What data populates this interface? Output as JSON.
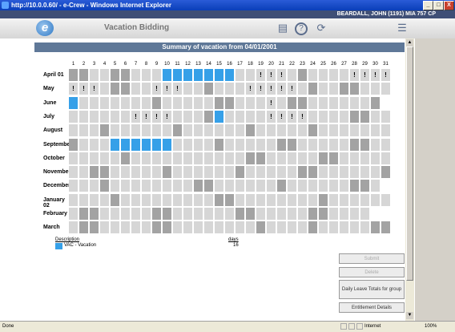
{
  "window": {
    "title": "http://10.0.0.60/ - e-Crew - Windows Internet Explorer",
    "minimize": "_",
    "maximize": "□",
    "close": "X"
  },
  "header": {
    "user": "BEARDALL, JOHN (1191) MIA 757 CP"
  },
  "toolbar": {
    "logo_letter": "e",
    "app_title": "Vacation Bidding",
    "print_icon": "printer-icon",
    "help_icon": "help-icon",
    "exit_icon": "exit-icon",
    "help_glyph": "?",
    "exit_glyph": "⟳",
    "print_glyph": "▤",
    "panel_glyph": "☰"
  },
  "summary": {
    "title": "Summary of vacation from  04/01/2001",
    "days": [
      "1",
      "2",
      "3",
      "4",
      "5",
      "6",
      "7",
      "8",
      "9",
      "10",
      "11",
      "12",
      "13",
      "14",
      "15",
      "16",
      "17",
      "18",
      "19",
      "20",
      "21",
      "22",
      "23",
      "24",
      "25",
      "26",
      "27",
      "28",
      "29",
      "30",
      "31"
    ],
    "months": [
      "April 01",
      "May",
      "June",
      "July",
      "August",
      "September",
      "October",
      "November",
      "December",
      "January 02",
      "February",
      "March"
    ],
    "rows": [
      "WWDDWWDDDBBBBBBBDD!!!DWDDDD!!!!!",
      "!!!DWWDD!!!DDWDDD!!!!!DWDDWWDDD",
      "BDDDDDDDWDDDDDWWDDD!DWWDDDDDDWL",
      "DDDDDD!!!!DDDWBDDDD!!!!DDDDWWDD",
      "DDDWDDDDDDWDDDDDDWDDDDDWDDDDDDD",
      "WDDDBBBBBBDDDDWDDDDDWWDDDDDWWDD",
      "DDDDDWDDDDDDDDDDDWWDDDDDWWDDDDD",
      "DDWWDDDDDWDDDDDDWDDDDDWWDDDDDDW",
      "DDDWDDDDDDDDWWDDDDDDWDDDDDDWWDL",
      "DDDDWDDDDDDDDDWWDDDDDDDDWDDDDDD",
      "DWWDDDDDWWDDDDDDWWDDDDDWWDDDDLL",
      "DWWDDDDDWWDDDDDDDDWDDDDWDDDDDWW"
    ]
  },
  "legend": {
    "description_header": "Description",
    "days_header": "days",
    "items": [
      {
        "label": "VAC - Vacation",
        "days": "16"
      }
    ]
  },
  "buttons": {
    "submit": "Submit",
    "delete": "Delete",
    "daily_leave": "Daily Leave Totals for group",
    "entitlement": "Entitlement Details"
  },
  "statusbar": {
    "status": "Done",
    "zone": "Internet",
    "zoom": "100%"
  },
  "colors": {
    "vacation": "#36a0e8",
    "weekday": "#d6d6d6",
    "weekend": "#a3a3a3",
    "blocked": "#8a8a8a",
    "empty": "#ffffff"
  }
}
